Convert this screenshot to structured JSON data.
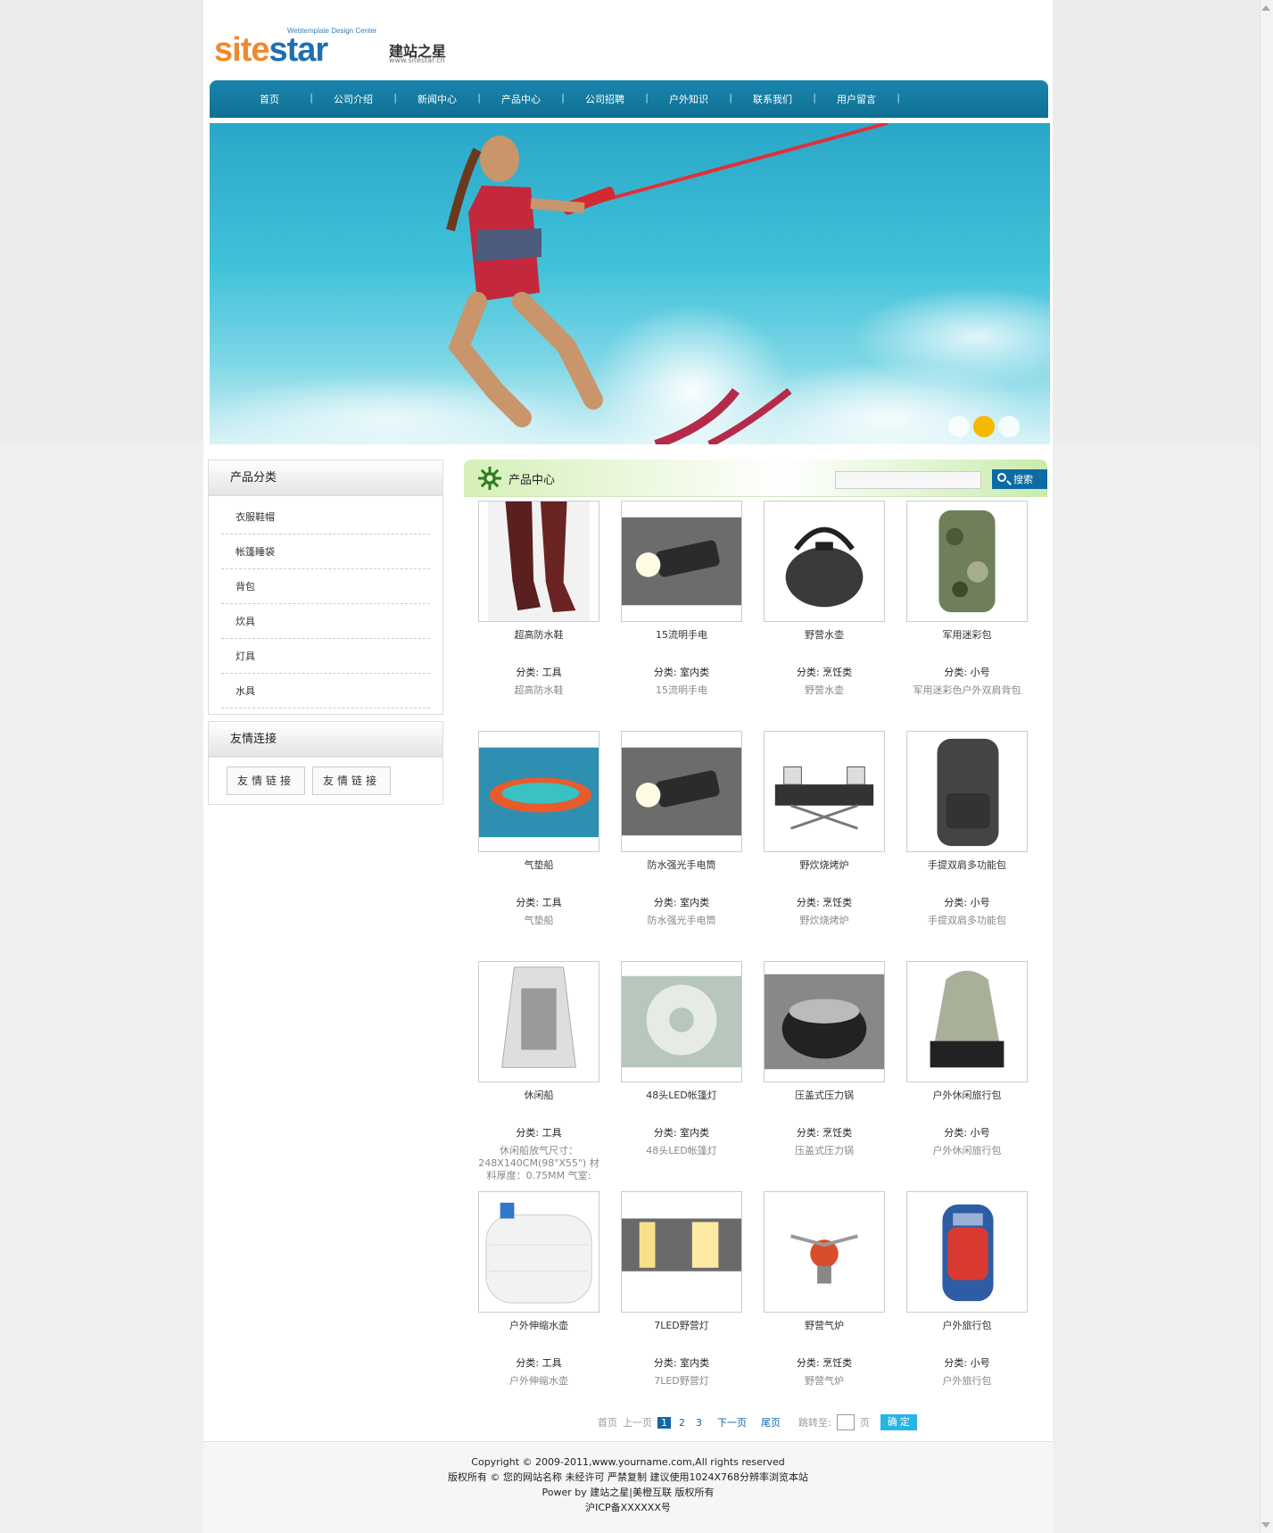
{
  "logo": {
    "tagline": "Webtemplate Design Center",
    "word_orange": "site",
    "word_blue": "star",
    "cn": "建站之星",
    "url": "www.sitestar.cn"
  },
  "nav": [
    "首页",
    "公司介绍",
    "新闻中心",
    "产品中心",
    "公司招聘",
    "户外知识",
    "联系我们",
    "用户留言"
  ],
  "sidebar": {
    "categories_title": "产品分类",
    "categories": [
      "衣服鞋帽",
      "帐篷睡袋",
      "背包",
      "炊具",
      "灯具",
      "水具"
    ],
    "links_title": "友情连接",
    "links": [
      "友情链接",
      "友情链接"
    ]
  },
  "main": {
    "title": "产品中心",
    "search_placeholder": "",
    "search_button": "搜索"
  },
  "products": [
    {
      "name": "超高防水鞋",
      "category": "分类: 工具",
      "desc": "超高防水鞋",
      "icon": "waders"
    },
    {
      "name": "15流明手电",
      "category": "分类: 室内类",
      "desc": "15流明手电",
      "icon": "flashlight"
    },
    {
      "name": "野营水壶",
      "category": "分类: 烹饪类",
      "desc": "野营水壶",
      "icon": "kettle"
    },
    {
      "name": "军用迷彩包",
      "category": "分类: 小号",
      "desc": "军用迷彩色户外双肩背包",
      "icon": "camo-backpack"
    },
    {
      "name": "气垫船",
      "category": "分类: 工具",
      "desc": "气垫船",
      "icon": "inflatable-raft"
    },
    {
      "name": "防水强光手电筒",
      "category": "分类: 室内类",
      "desc": "防水强光手电筒",
      "icon": "flashlight"
    },
    {
      "name": "野炊烧烤炉",
      "category": "分类: 烹饪类",
      "desc": "野炊烧烤炉",
      "icon": "grill"
    },
    {
      "name": "手提双肩多功能包",
      "category": "分类: 小号",
      "desc": "手提双肩多功能包",
      "icon": "backpack"
    },
    {
      "name": "休闲船",
      "category": "分类: 工具",
      "desc": "休闲船放气尺寸：248X140CM(98\"X55\") 材料厚度：0.75MM 气室:",
      "icon": "boat"
    },
    {
      "name": "48头LED帐篷灯",
      "category": "分类: 室内类",
      "desc": "48头LED帐篷灯",
      "icon": "led-lamp"
    },
    {
      "name": "压盖式压力锅",
      "category": "分类: 烹饪类",
      "desc": "压盖式压力锅",
      "icon": "pressure-cooker"
    },
    {
      "name": "户外休闲旅行包",
      "category": "分类: 小号",
      "desc": "户外休闲旅行包",
      "icon": "travel-bag"
    },
    {
      "name": "户外伸缩水壶",
      "category": "分类: 工具",
      "desc": "户外伸缩水壶",
      "icon": "water-container"
    },
    {
      "name": "7LED野营灯",
      "category": "分类: 室内类",
      "desc": "7LED野营灯",
      "icon": "lantern"
    },
    {
      "name": "野营气炉",
      "category": "分类: 烹饪类",
      "desc": "野营气炉",
      "icon": "gas-stove"
    },
    {
      "name": "户外旅行包",
      "category": "分类: 小号",
      "desc": "户外旅行包",
      "icon": "hiking-backpack"
    }
  ],
  "pager": {
    "first": "首页",
    "prev": "上一页",
    "pages": [
      "1",
      "2",
      "3"
    ],
    "current": "1",
    "next": "下一页",
    "last": "尾页",
    "jump_label": "跳转至:",
    "page_unit": "页",
    "go": "确 定"
  },
  "footer": {
    "line1": "Copyright © 2009-2011,www.yourname.com,All rights reserved",
    "line2": "版权所有 © 您的网站名称  未经许可  严禁复制  建议使用1024X768分辨率浏览本站",
    "line3": "Power by 建站之星|美橙互联 版权所有",
    "line4": "沪ICP备XXXXXX号"
  },
  "colors": {
    "nav": "#0f6f94",
    "search_button": "#0d6ba3",
    "pager_active": "#1466a6",
    "dot_active": "#f6b800"
  }
}
